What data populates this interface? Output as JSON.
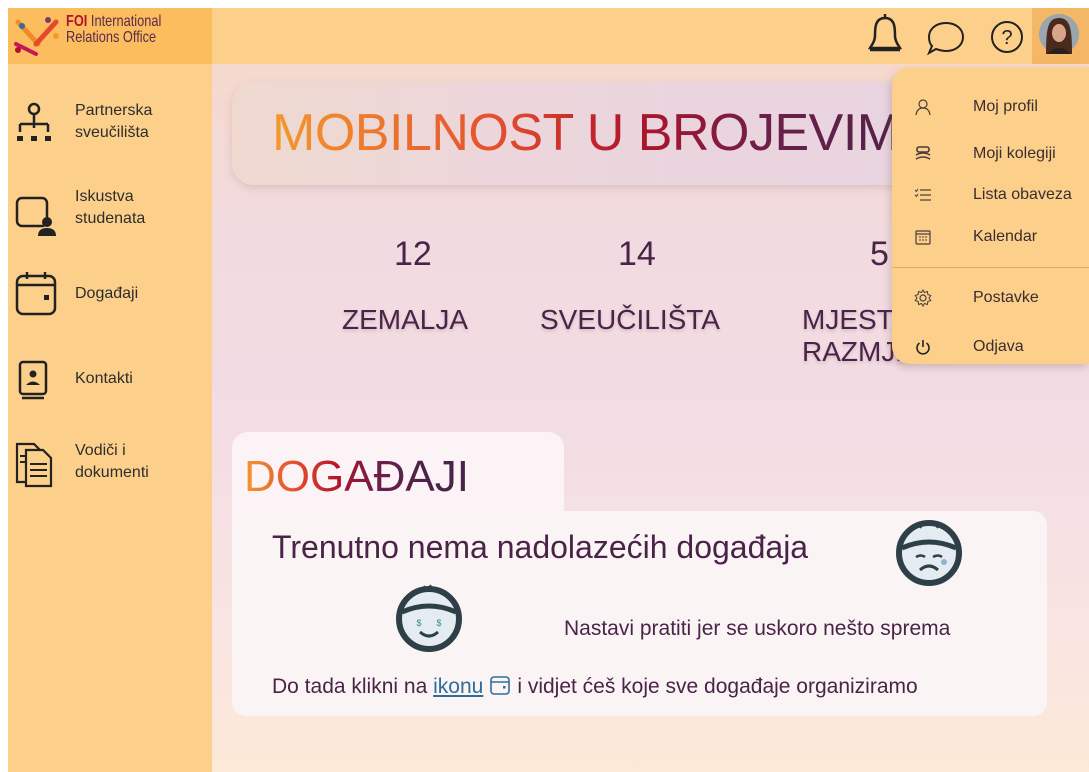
{
  "app": {
    "logo_brand": "FOI",
    "logo_line1": "International",
    "logo_line2": "Relations Office"
  },
  "sidebar": {
    "items": [
      {
        "line1": "Partnerska",
        "line2": "sveučilišta",
        "icon": "hierarchy-icon"
      },
      {
        "line1": "Iskustva",
        "line2": "studenata",
        "icon": "student-experience-icon"
      },
      {
        "line1": "Događaji",
        "line2": "",
        "icon": "calendar-icon"
      },
      {
        "line1": "Kontakti",
        "line2": "",
        "icon": "contact-book-icon"
      },
      {
        "line1": "Vodiči i",
        "line2": "dokumenti",
        "icon": "documents-icon"
      }
    ]
  },
  "topbar": {
    "icons": [
      "bell-icon",
      "chat-icon",
      "help-icon",
      "avatar"
    ]
  },
  "hero": {
    "title": "MOBILNOST U BROJEVIMA"
  },
  "stats": [
    {
      "number": "12",
      "label": "ZEMALJA"
    },
    {
      "number": "14",
      "label": "SVEUČILIŠTA"
    },
    {
      "number": "5",
      "label_line1": "MJESTA",
      "label_line2": "RAZMJENE"
    }
  ],
  "events": {
    "title": "DOGAĐAJI",
    "no_events": "Trenutno nema nadolazećih događaja",
    "continue": "Nastavi pratiti jer se uskoro nešto sprema",
    "hint_before": "Do tada klikni na",
    "hint_link": "ikonu",
    "hint_after": "i vidjet ćeš koje sve događaje organiziramo"
  },
  "dropdown": {
    "items": [
      {
        "label": "Moj profil",
        "icon": "profile-icon"
      },
      {
        "label": "Moji kolegiji",
        "icon": "courses-icon"
      },
      {
        "label": "Lista obaveza",
        "icon": "checklist-icon"
      },
      {
        "label": "Kalendar",
        "icon": "calendar-icon"
      },
      {
        "label": "Postavke",
        "icon": "gear-icon"
      },
      {
        "label": "Odjava",
        "icon": "power-icon"
      }
    ]
  },
  "colors": {
    "sidebar": "#fcd08a",
    "logo_bg": "#fbbd5e",
    "text_dark": "#4a2448",
    "link": "#2f6e9a",
    "accent_red": "#b0142a",
    "accent_orange": "#f29a2e"
  }
}
